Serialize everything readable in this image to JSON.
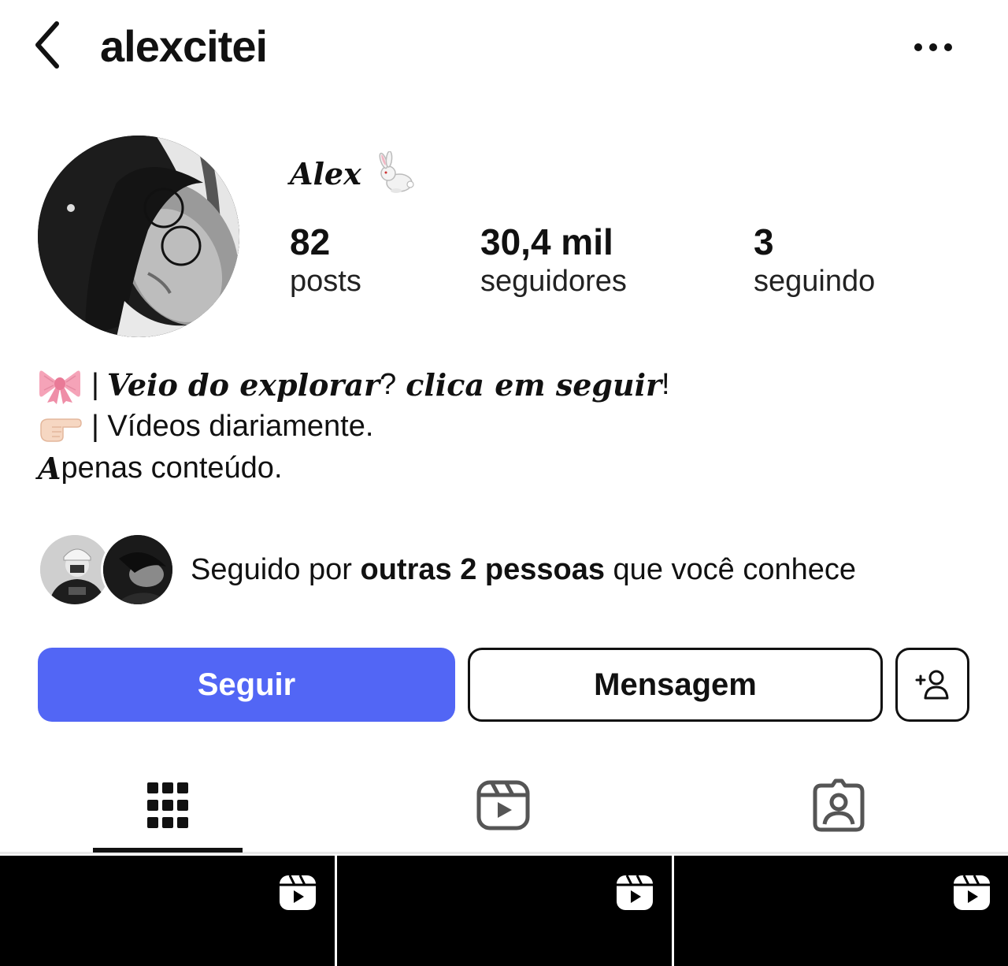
{
  "header": {
    "username": "alexcitei",
    "back_icon": "chevron-left-icon",
    "more_icon": "more-horizontal-icon"
  },
  "profile": {
    "display_name": "Alex",
    "display_name_emoji": "rabbit-icon",
    "stats": [
      {
        "value": "82",
        "label": "posts"
      },
      {
        "value": "30,4 mil",
        "label": "seguidores"
      },
      {
        "value": "3",
        "label": "seguindo"
      }
    ]
  },
  "bio": {
    "line1_sep": "|",
    "line1_italic": "Veio do explorar",
    "line1_q": "?",
    "line1_italic2": "clica em seguir",
    "line1_end": "!",
    "line2_text": "| Vídeos diariamente.",
    "line3_initial": "A",
    "line3_rest": "penas conteúdo."
  },
  "followed_by": {
    "prefix": "Seguido por",
    "bold": "outras 2 pessoas",
    "suffix": "que você conhece"
  },
  "actions": {
    "follow_label": "Seguir",
    "message_label": "Mensagem",
    "suggest_icon": "add-person-icon"
  },
  "tabs": [
    {
      "icon": "grid-icon",
      "active": true
    },
    {
      "icon": "reels-icon",
      "active": false
    },
    {
      "icon": "tagged-icon",
      "active": false
    }
  ],
  "colors": {
    "accent": "#5266f5",
    "text": "#111111",
    "background": "#ffffff"
  }
}
